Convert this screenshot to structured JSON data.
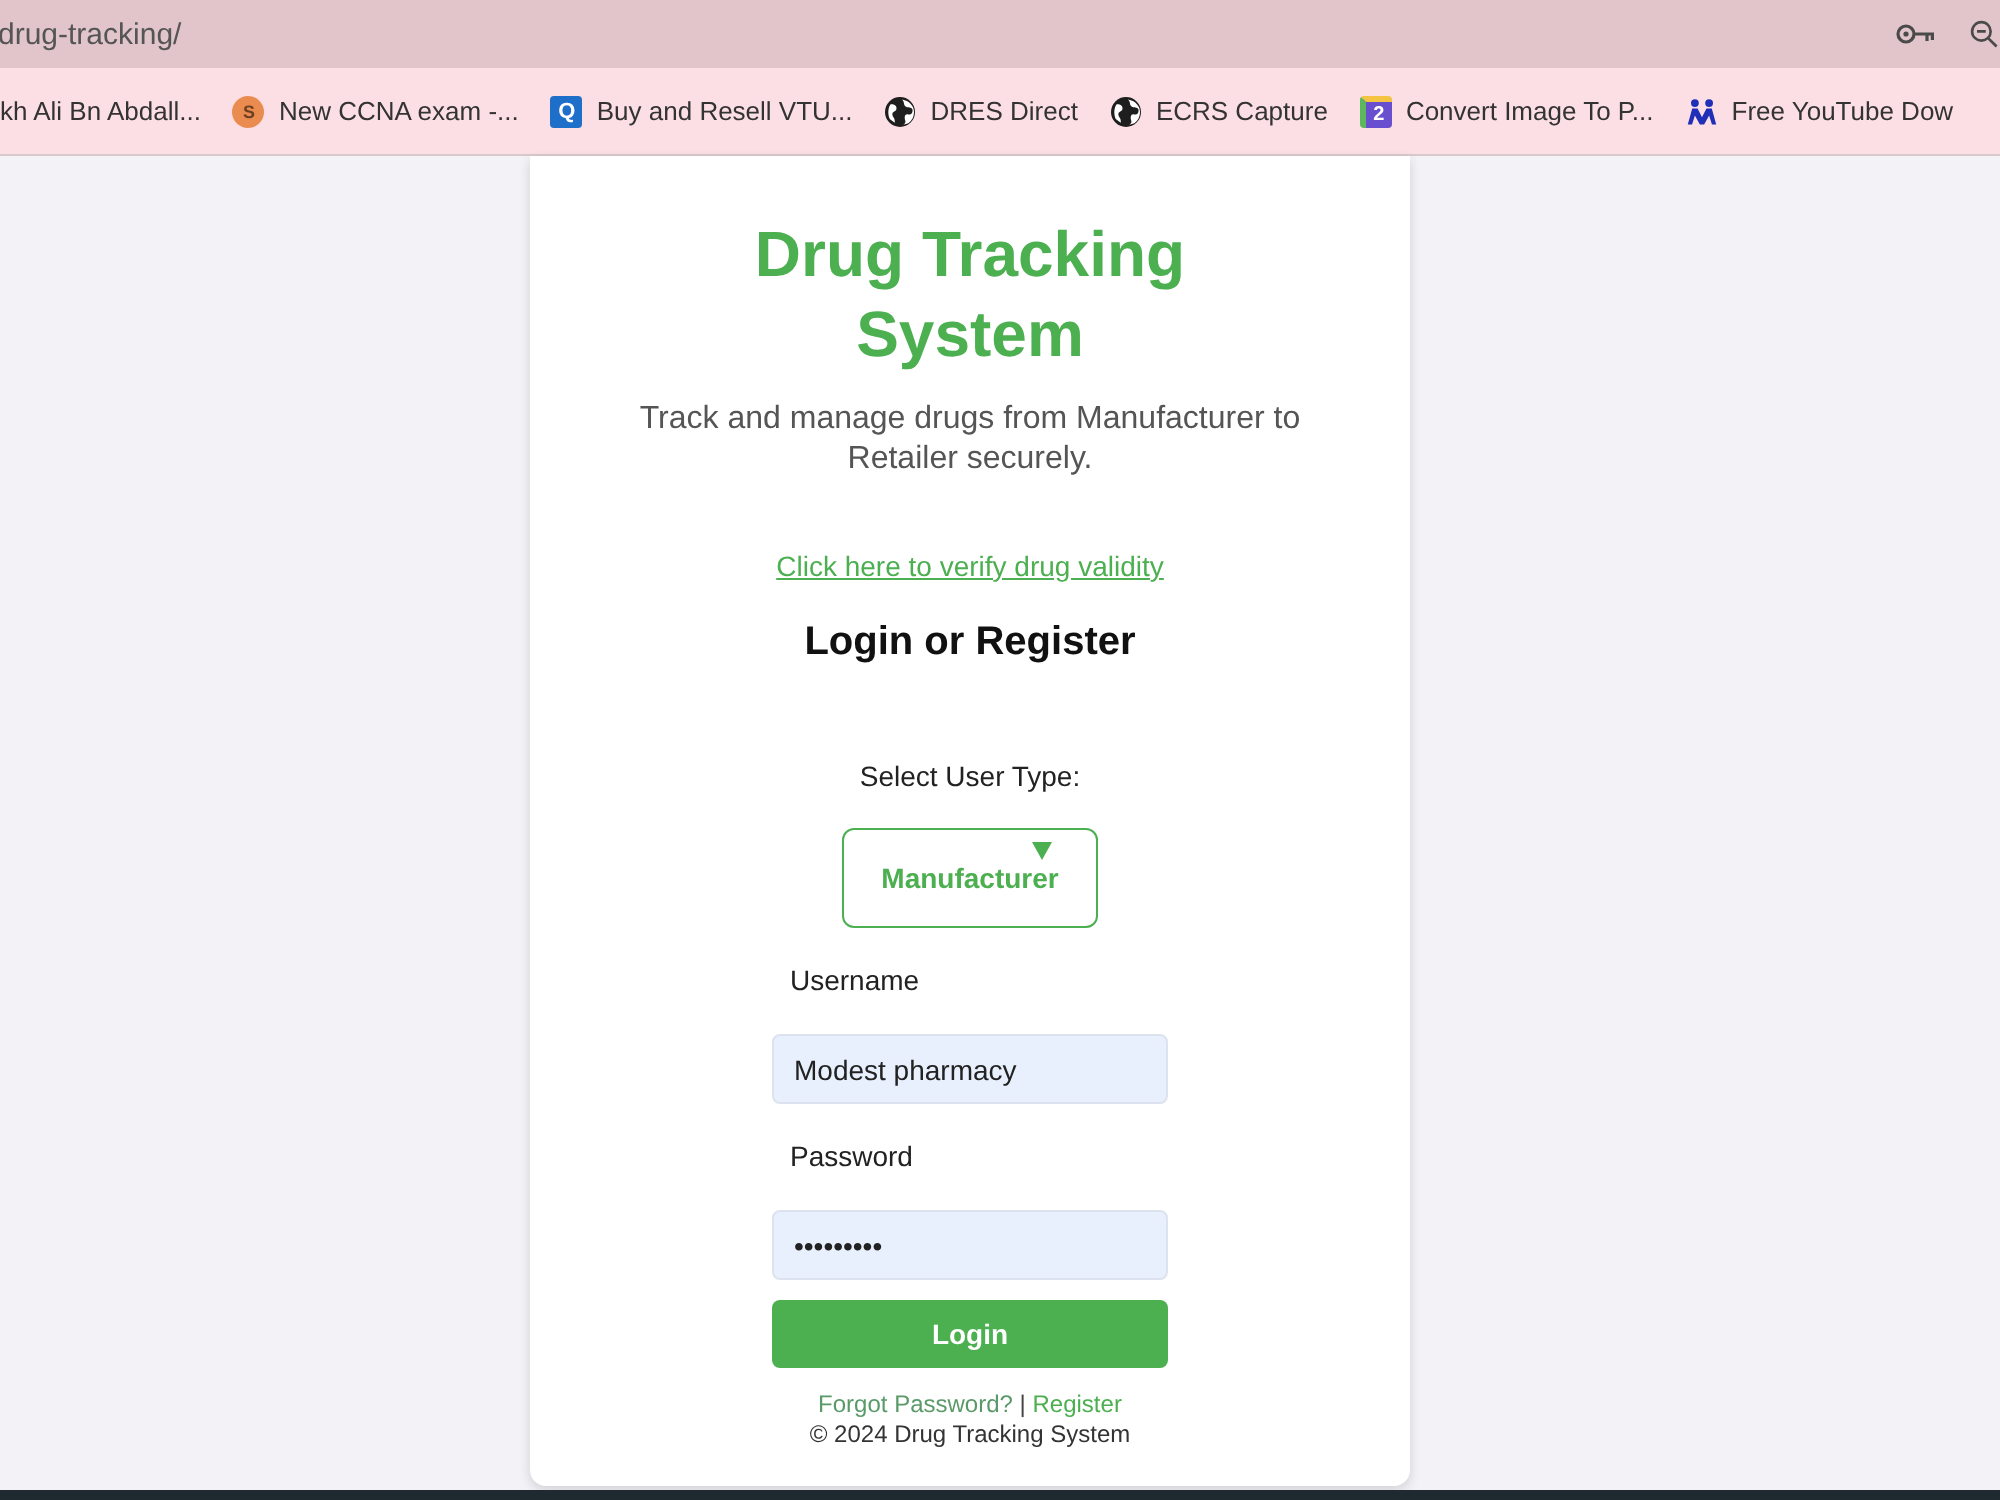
{
  "browser": {
    "address": "drug-tracking/",
    "bookmarks": [
      {
        "kind": "plain",
        "label": "kh Ali Bn Abdall..."
      },
      {
        "kind": "letter-disc",
        "icon_text": "S",
        "label": "New CCNA exam -..."
      },
      {
        "kind": "letter-tile",
        "icon_text": "Q",
        "label": "Buy and Resell VTU..."
      },
      {
        "kind": "globe",
        "label": "DRES Direct"
      },
      {
        "kind": "globe",
        "label": "ECRS Capture"
      },
      {
        "kind": "number-tile",
        "icon_text": "2",
        "label": "Convert Image To P..."
      },
      {
        "kind": "people",
        "label": "Free YouTube Dow"
      }
    ]
  },
  "card": {
    "title": "Drug Tracking System",
    "subtitle": "Track and manage drugs from Manufacturer to Retailer securely.",
    "verify_link": "Click here to verify drug validity",
    "heading": "Login or Register",
    "user_type": {
      "label": "Select User Type:",
      "value": "Manufacturer"
    },
    "fields": [
      {
        "label": "Username",
        "value": "Modest pharmacy"
      },
      {
        "label": "Password",
        "value": "•••••••••"
      }
    ],
    "login_button": "Login",
    "footer": {
      "links": [
        "Forgot Password?",
        "Register"
      ],
      "separator": "|",
      "copyright": "© 2024 Drug Tracking System"
    }
  }
}
